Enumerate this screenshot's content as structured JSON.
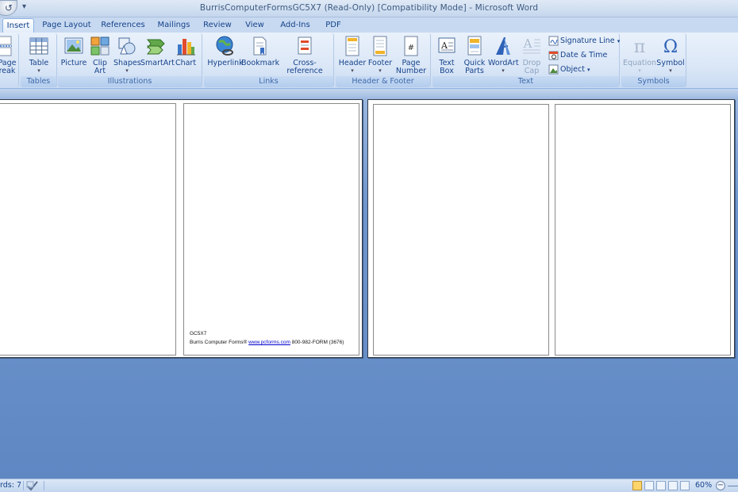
{
  "window": {
    "title": "BurrisComputerFormsGC5X7 (Read-Only) [Compatibility Mode] - Microsoft Word"
  },
  "tabs": [
    {
      "label": "Insert",
      "active": true
    },
    {
      "label": "Page Layout"
    },
    {
      "label": "References"
    },
    {
      "label": "Mailings"
    },
    {
      "label": "Review"
    },
    {
      "label": "View"
    },
    {
      "label": "Add-Ins"
    },
    {
      "label": "PDF"
    }
  ],
  "ribbon": {
    "pages": {
      "page_break_l1": "Page",
      "page_break_l2": "reak"
    },
    "tables": {
      "table": "Table",
      "label": "Tables"
    },
    "illustrations": {
      "picture": "Picture",
      "clip_art_l1": "Clip",
      "clip_art_l2": "Art",
      "shapes": "Shapes",
      "smartart": "SmartArt",
      "chart": "Chart",
      "label": "Illustrations"
    },
    "links": {
      "hyperlink": "Hyperlink",
      "bookmark": "Bookmark",
      "cross_reference": "Cross-reference",
      "label": "Links"
    },
    "header_footer": {
      "header": "Header",
      "footer": "Footer",
      "page_number_l1": "Page",
      "page_number_l2": "Number",
      "label": "Header & Footer"
    },
    "text": {
      "text_box_l1": "Text",
      "text_box_l2": "Box",
      "quick_parts_l1": "Quick",
      "quick_parts_l2": "Parts",
      "wordart": "WordArt",
      "drop_cap_l1": "Drop",
      "drop_cap_l2": "Cap",
      "signature_line": "Signature Line",
      "date_time": "Date & Time",
      "object": "Object",
      "label": "Text"
    },
    "symbols": {
      "equation": "Equation",
      "symbol": "Symbol",
      "label": "Symbols"
    }
  },
  "document": {
    "footer_code": "GC5X7",
    "footer_company": "Burris Computer Forms®",
    "footer_link": "www.pcforms.com",
    "footer_phone": "800-982-FORM (3676)"
  },
  "statusbar": {
    "words": "rds: 7",
    "zoom": "60%"
  },
  "colors": {
    "ribbon_bg": "#dbe7f7",
    "doc_bg": "#6f95cc",
    "label_text": "#15428b",
    "active_view": "#ffd56b"
  }
}
